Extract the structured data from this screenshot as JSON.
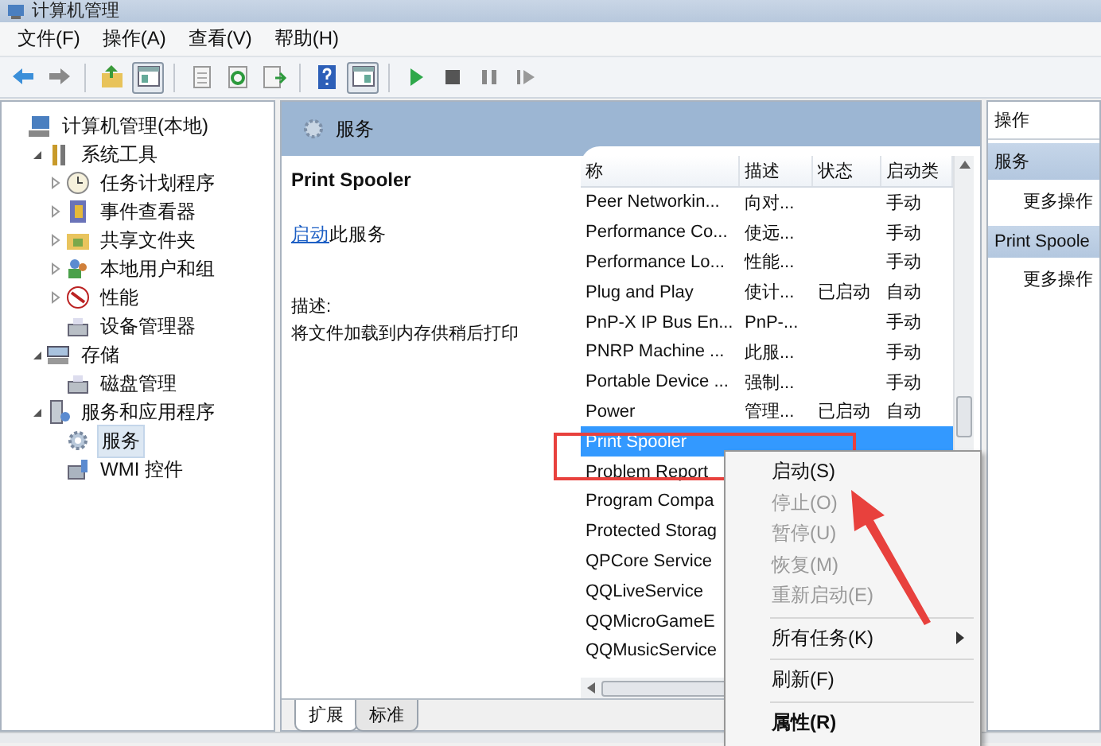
{
  "window": {
    "title": "计算机管理"
  },
  "menu_bar": [
    {
      "label": "文件(F)"
    },
    {
      "label": "操作(A)"
    },
    {
      "label": "查看(V)"
    },
    {
      "label": "帮助(H)"
    }
  ],
  "tree": [
    {
      "label": "计算机管理(本地)",
      "selected": false,
      "children": [
        {
          "label": "系统工具",
          "selected": false,
          "expanded": true,
          "children": [
            {
              "label": "任务计划程序",
              "selected": false,
              "expanded": false
            },
            {
              "label": "事件查看器",
              "selected": false,
              "expanded": false
            },
            {
              "label": "共享文件夹",
              "selected": false,
              "expanded": false
            },
            {
              "label": "本地用户和组",
              "selected": false,
              "expanded": false
            },
            {
              "label": "性能",
              "selected": false,
              "expanded": false
            },
            {
              "label": "设备管理器",
              "selected": false
            }
          ]
        },
        {
          "label": "存储",
          "selected": false,
          "expanded": true,
          "children": [
            {
              "label": "磁盘管理",
              "selected": false
            }
          ]
        },
        {
          "label": "服务和应用程序",
          "selected": false,
          "expanded": true,
          "children": [
            {
              "label": "服务",
              "selected": true
            },
            {
              "label": "WMI 控件",
              "selected": false
            }
          ]
        }
      ]
    }
  ],
  "center": {
    "title": "服务",
    "details": {
      "name": "Print Spooler",
      "action_link": "启动",
      "action_text": "此服务",
      "description_label": "描述:",
      "description": "将文件加载到内存供稍后打印"
    },
    "table": {
      "columns": [
        "称",
        "描述",
        "状态",
        "启动类"
      ],
      "rows": [
        {
          "name": "Peer Networkin...",
          "description": "向对...",
          "startup": "手动",
          "selected": false
        },
        {
          "name": "Performance Co...",
          "description": "使远...",
          "startup": "手动",
          "selected": false
        },
        {
          "name": "Performance Lo...",
          "description": "性能...",
          "startup": "手动",
          "selected": false
        },
        {
          "name": "Plug and Play",
          "description": "使计...",
          "status": "已启动",
          "startup": "自动",
          "selected": false
        },
        {
          "name": "PnP-X IP Bus En...",
          "description": "PnP-...",
          "startup": "手动",
          "selected": false
        },
        {
          "name": "PNRP Machine ...",
          "description": "此服...",
          "startup": "手动",
          "selected": false
        },
        {
          "name": "Portable Device ...",
          "description": "强制...",
          "startup": "手动",
          "selected": false
        },
        {
          "name": "Power",
          "description": "管理...",
          "status": "已启动",
          "startup": "自动",
          "selected": false
        },
        {
          "name": "Print Spooler",
          "selected": true
        },
        {
          "name": "Problem Report",
          "selected": false
        },
        {
          "name": "Program Compa",
          "selected": false
        },
        {
          "name": "Protected Storag",
          "selected": false
        },
        {
          "name": "QPCore Service",
          "selected": false
        },
        {
          "name": "QQLiveService",
          "selected": false
        },
        {
          "name": "QQMicroGameE",
          "selected": false
        },
        {
          "name": "QQMusicService",
          "selected": false
        }
      ]
    },
    "tabs": [
      {
        "label": "扩展",
        "selected": true
      },
      {
        "label": "标准",
        "selected": false
      }
    ]
  },
  "actions": {
    "title": "操作",
    "sections": [
      {
        "title": "服务",
        "items": [
          "更多操作"
        ]
      },
      {
        "title": "Print Spoole",
        "items": [
          "更多操作"
        ]
      }
    ]
  },
  "context_menu": [
    {
      "kind": "item",
      "label": "启动(S)",
      "disabled": false
    },
    {
      "kind": "item",
      "label": "停止(O)",
      "disabled": true
    },
    {
      "kind": "item",
      "label": "暂停(U)",
      "disabled": true
    },
    {
      "kind": "item",
      "label": "恢复(M)",
      "disabled": true
    },
    {
      "kind": "item",
      "label": "重新启动(E)",
      "disabled": true
    },
    {
      "kind": "separator"
    },
    {
      "kind": "submenu",
      "label": "所有任务(K)",
      "disabled": false
    },
    {
      "kind": "separator"
    },
    {
      "kind": "item",
      "label": "刷新(F)",
      "disabled": false
    },
    {
      "kind": "separator"
    },
    {
      "kind": "default",
      "label": "属性(R)",
      "disabled": false
    }
  ]
}
